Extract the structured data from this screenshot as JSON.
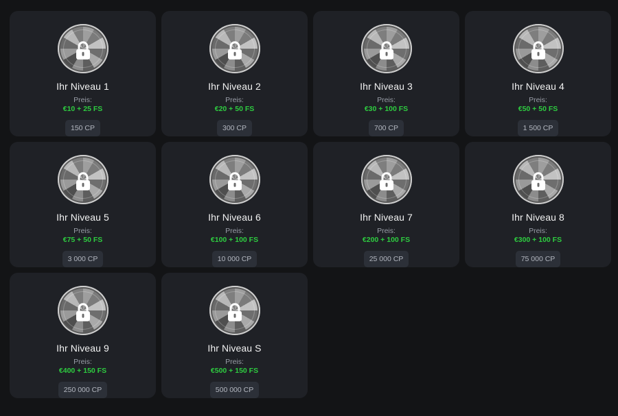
{
  "price_label": "Preis:",
  "levels": [
    {
      "title": "Ihr Niveau 1",
      "price": "€10 + 25 FS",
      "cp": "150 CP"
    },
    {
      "title": "Ihr Niveau 2",
      "price": "€20 + 50 FS",
      "cp": "300 CP"
    },
    {
      "title": "Ihr Niveau 3",
      "price": "€30 + 100 FS",
      "cp": "700 CP"
    },
    {
      "title": "Ihr Niveau 4",
      "price": "€50 + 50 FS",
      "cp": "1 500 CP"
    },
    {
      "title": "Ihr Niveau 5",
      "price": "€75 + 50 FS",
      "cp": "3 000 CP"
    },
    {
      "title": "Ihr Niveau 6",
      "price": "€100 + 100 FS",
      "cp": "10 000 CP"
    },
    {
      "title": "Ihr Niveau 7",
      "price": "€200 + 100 FS",
      "cp": "25 000 CP"
    },
    {
      "title": "Ihr Niveau 8",
      "price": "€300 + 100 FS",
      "cp": "75 000 CP"
    },
    {
      "title": "Ihr Niveau 9",
      "price": "€400 + 150 FS",
      "cp": "250 000 CP"
    },
    {
      "title": "Ihr Niveau S",
      "price": "€500 + 150 FS",
      "cp": "500 000 CP"
    }
  ],
  "icons": {
    "badge": "locked-medal-icon",
    "lock": "padlock-icon"
  },
  "colors": {
    "background": "#131416",
    "card": "#1f2126",
    "price_green": "#2ecc40",
    "chip": "#2c3038"
  }
}
